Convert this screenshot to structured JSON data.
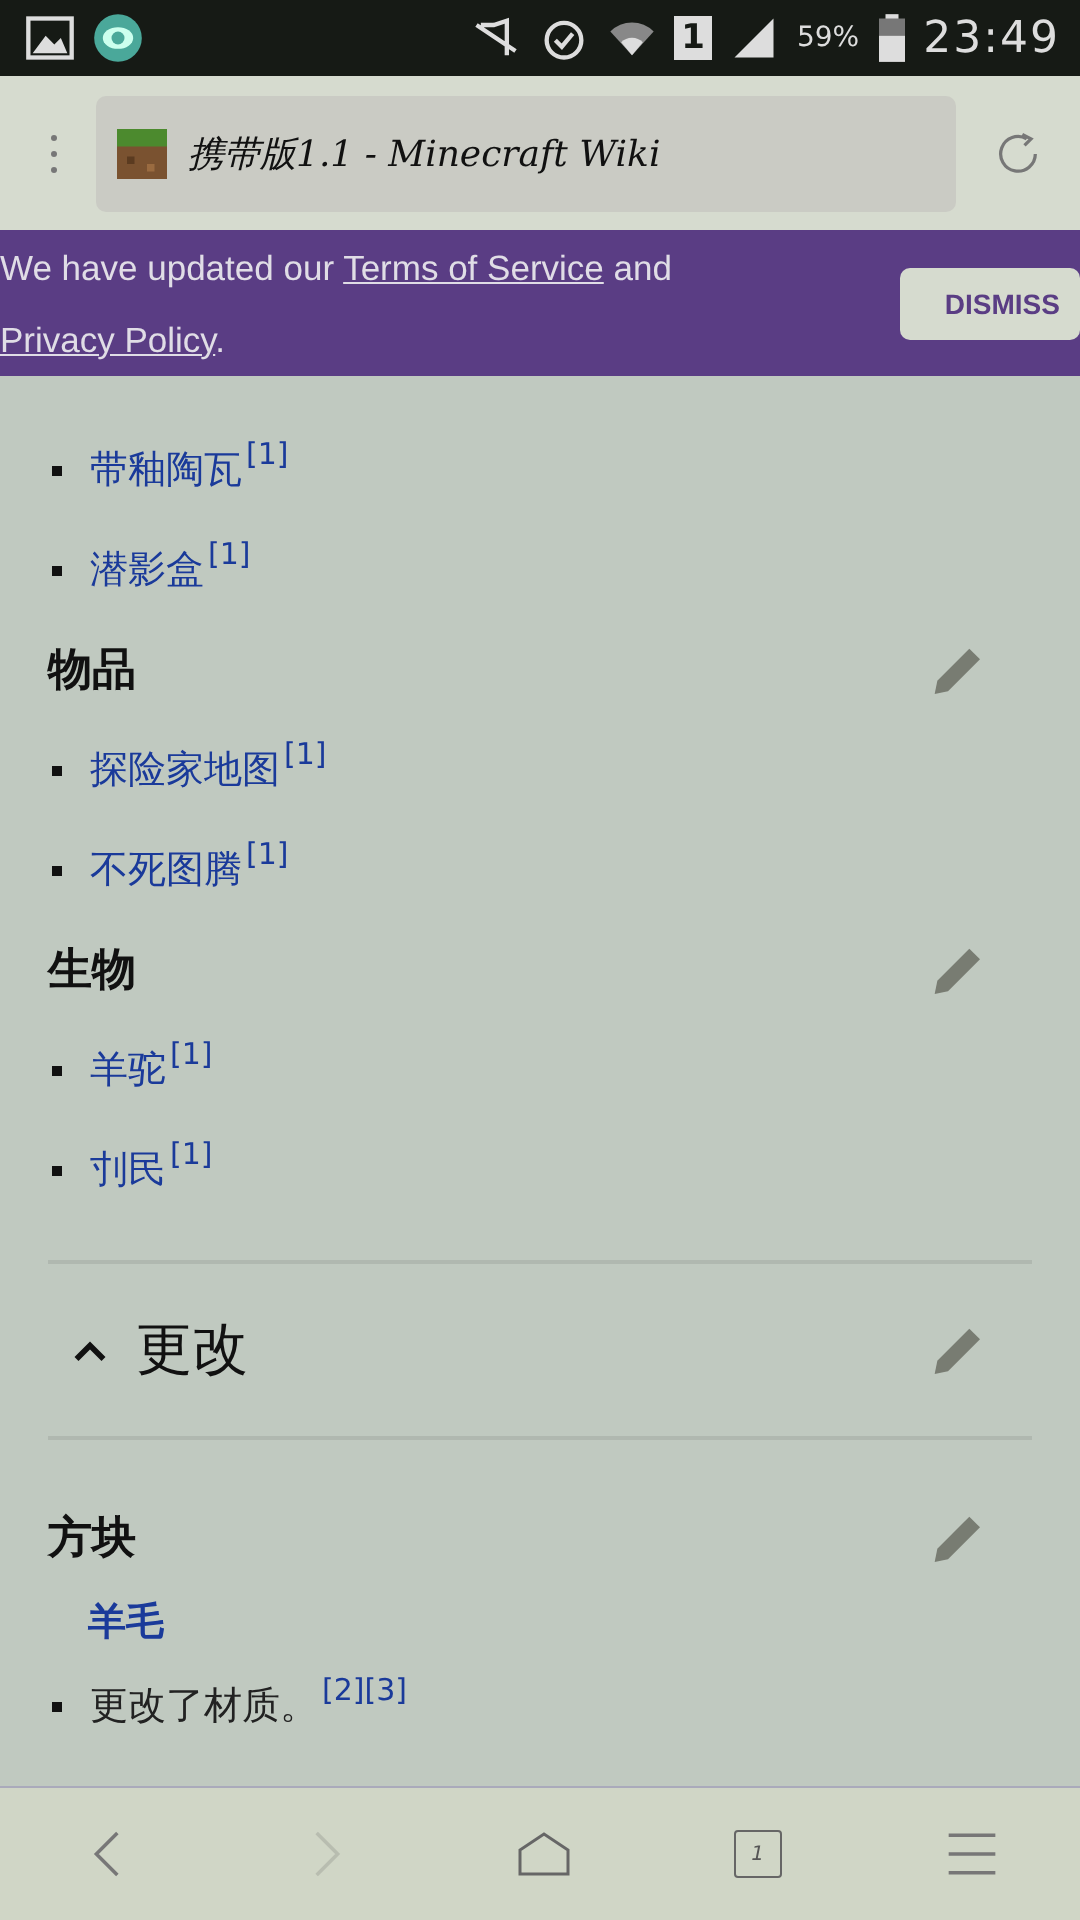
{
  "status_bar": {
    "sim": "1",
    "battery": "59%",
    "time": "23:49"
  },
  "browser": {
    "title": "携带版1.1 - Minecraft Wiki"
  },
  "banner": {
    "parts": [
      {
        "kind": "text",
        "text": "We have updated our "
      },
      {
        "kind": "link",
        "text": "Terms of Service"
      },
      {
        "kind": "text",
        "text": " and "
      },
      {
        "kind": "link",
        "text": "Privacy Policy"
      },
      {
        "kind": "text",
        "text": "."
      }
    ],
    "dismiss": "DISMISS"
  },
  "content": [
    {
      "kind": "item",
      "text": "带釉陶瓦",
      "ref": "[1]",
      "link": true
    },
    {
      "kind": "item",
      "text": "潜影盒",
      "ref": "[1]",
      "link": true
    },
    {
      "kind": "heading",
      "text": "物品"
    },
    {
      "kind": "item",
      "text": "探险家地图",
      "ref": "[1]",
      "link": true
    },
    {
      "kind": "item",
      "text": "不死图腾",
      "ref": "[1]",
      "link": true
    },
    {
      "kind": "heading",
      "text": "生物"
    },
    {
      "kind": "item",
      "text": "羊驼",
      "ref": "[1]",
      "link": true
    },
    {
      "kind": "item",
      "text": "刌民",
      "ref": "[1]",
      "link": true
    },
    {
      "kind": "section",
      "text": "更改",
      "expanded": true
    },
    {
      "kind": "heading",
      "text": "方块"
    },
    {
      "kind": "subheading",
      "text": "羊毛"
    },
    {
      "kind": "item",
      "text": "更改了材质。",
      "ref": "[2][3]",
      "link": false
    }
  ],
  "nav": {
    "back_disabled": false,
    "forward_disabled": true,
    "tab_count": "1"
  }
}
